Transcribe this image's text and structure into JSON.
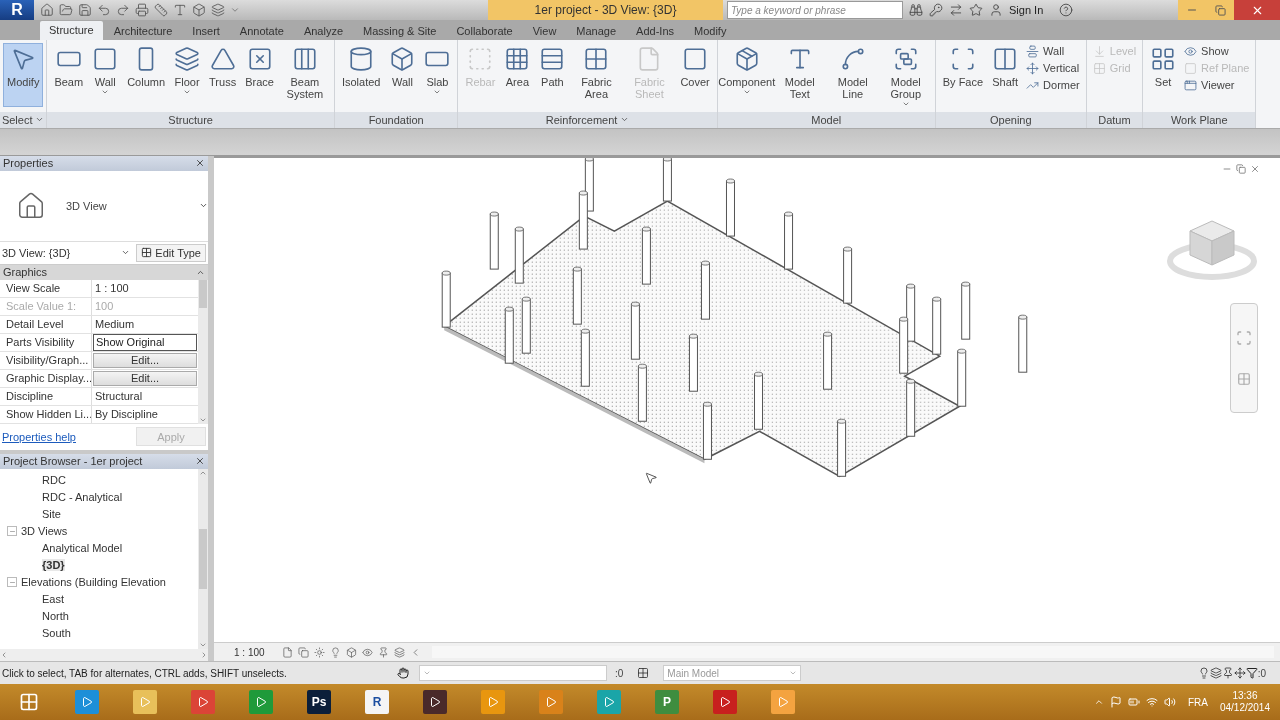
{
  "title_bar": {
    "app_button": "R",
    "title": "1er project - 3D View: {3D}",
    "search_placeholder": "Type a keyword or phrase",
    "sign_in": "Sign In"
  },
  "ribbon_tabs": [
    {
      "label": "Structure",
      "selected": true
    },
    {
      "label": "Architecture",
      "selected": false
    },
    {
      "label": "Insert",
      "selected": false
    },
    {
      "label": "Annotate",
      "selected": false
    },
    {
      "label": "Analyze",
      "selected": false
    },
    {
      "label": "Massing & Site",
      "selected": false
    },
    {
      "label": "Collaborate",
      "selected": false
    },
    {
      "label": "View",
      "selected": false
    },
    {
      "label": "Manage",
      "selected": false
    },
    {
      "label": "Add-Ins",
      "selected": false
    },
    {
      "label": "Modify",
      "selected": false
    }
  ],
  "ribbon_panels": [
    {
      "name": "Select",
      "menu": true,
      "tools": [
        {
          "label": "Modify",
          "kind": "large",
          "selected": true,
          "disabled": false
        }
      ]
    },
    {
      "name": "Structure",
      "tools": [
        {
          "label": "Beam",
          "kind": "large",
          "selected": false,
          "disabled": false
        },
        {
          "label": "Wall",
          "kind": "large",
          "selected": false,
          "disabled": false,
          "dropdown": true
        },
        {
          "label": "Column",
          "kind": "large",
          "selected": false,
          "disabled": false
        },
        {
          "label": "Floor",
          "kind": "large",
          "selected": false,
          "disabled": false,
          "dropdown": true
        },
        {
          "label": "Truss",
          "kind": "large",
          "selected": false,
          "disabled": false
        },
        {
          "label": "Brace",
          "kind": "large",
          "selected": false,
          "disabled": false
        },
        {
          "label": "Beam System",
          "kind": "large",
          "selected": false,
          "disabled": false
        }
      ]
    },
    {
      "name": "Foundation",
      "tools": [
        {
          "label": "Isolated",
          "kind": "large",
          "selected": false,
          "disabled": false
        },
        {
          "label": "Wall",
          "kind": "large",
          "selected": false,
          "disabled": false
        },
        {
          "label": "Slab",
          "kind": "large",
          "selected": false,
          "disabled": false,
          "dropdown": true
        }
      ]
    },
    {
      "name": "Reinforcement",
      "menu": true,
      "tools": [
        {
          "label": "Rebar",
          "kind": "large",
          "selected": false,
          "disabled": true
        },
        {
          "label": "Area",
          "kind": "large",
          "selected": false,
          "disabled": false
        },
        {
          "label": "Path",
          "kind": "large",
          "selected": false,
          "disabled": false
        },
        {
          "label": "Fabric Area",
          "kind": "large",
          "selected": false,
          "disabled": false
        },
        {
          "label": "Fabric Sheet",
          "kind": "large",
          "selected": false,
          "disabled": true
        },
        {
          "label": "Cover",
          "kind": "large",
          "selected": false,
          "disabled": false
        }
      ]
    },
    {
      "name": "Model",
      "tools": [
        {
          "label": "Component",
          "kind": "large",
          "selected": false,
          "disabled": false,
          "dropdown": true
        },
        {
          "label": "Model Text",
          "kind": "large",
          "selected": false,
          "disabled": false
        },
        {
          "label": "Model Line",
          "kind": "large",
          "selected": false,
          "disabled": false
        },
        {
          "label": "Model Group",
          "kind": "large",
          "selected": false,
          "disabled": false,
          "dropdown": true
        }
      ]
    },
    {
      "name": "Opening",
      "tools": [
        {
          "label": "By Face",
          "kind": "large",
          "selected": false,
          "disabled": false
        },
        {
          "label": "Shaft",
          "kind": "large",
          "selected": false,
          "disabled": false
        },
        {
          "label": "Wall",
          "kind": "small",
          "selected": false,
          "disabled": false
        },
        {
          "label": "Vertical",
          "kind": "small",
          "selected": false,
          "disabled": false
        },
        {
          "label": "Dormer",
          "kind": "small",
          "selected": false,
          "disabled": false
        }
      ]
    },
    {
      "name": "Datum",
      "tools": [
        {
          "label": "Level",
          "kind": "small",
          "selected": false,
          "disabled": true
        },
        {
          "label": "Grid",
          "kind": "small",
          "selected": false,
          "disabled": true
        }
      ]
    },
    {
      "name": "Work Plane",
      "tools": [
        {
          "label": "Set",
          "kind": "large",
          "selected": false,
          "disabled": false
        },
        {
          "label": "Show",
          "kind": "small",
          "selected": false,
          "disabled": false
        },
        {
          "label": "Ref Plane",
          "kind": "small",
          "selected": false,
          "disabled": true
        },
        {
          "label": "Viewer",
          "kind": "small",
          "selected": false,
          "disabled": false
        }
      ]
    }
  ],
  "properties": {
    "title": "Properties",
    "type_name": "3D View",
    "instance": "3D View: {3D}",
    "edit_type": "Edit Type",
    "group": "Graphics",
    "rows": [
      {
        "name": "View Scale",
        "value": "1 : 100",
        "kind": "text",
        "disabled": false
      },
      {
        "name": "Scale Value    1:",
        "value": "100",
        "kind": "text",
        "disabled": true
      },
      {
        "name": "Detail Level",
        "value": "Medium",
        "kind": "text",
        "disabled": false
      },
      {
        "name": "Parts Visibility",
        "value": "Show Original",
        "kind": "field",
        "disabled": false
      },
      {
        "name": "Visibility/Graph...",
        "value": "Edit...",
        "kind": "button",
        "disabled": false
      },
      {
        "name": "Graphic Display...",
        "value": "Edit...",
        "kind": "button",
        "disabled": false
      },
      {
        "name": "Discipline",
        "value": "Structural",
        "kind": "text",
        "disabled": false
      },
      {
        "name": "Show Hidden Li...",
        "value": "By Discipline",
        "kind": "text",
        "disabled": false
      }
    ],
    "help_link": "Properties help",
    "apply": "Apply",
    "apply_disabled": true
  },
  "project_browser": {
    "title": "Project Browser - 1er project",
    "tree": [
      {
        "children": [
          {
            "label": "RDC",
            "selected": false
          },
          {
            "label": "RDC - Analytical",
            "selected": false
          },
          {
            "label": "Site",
            "selected": false
          }
        ]
      },
      {
        "label": "3D Views",
        "expanded": true,
        "selected": false,
        "children": [
          {
            "label": "Analytical Model",
            "selected": false
          },
          {
            "label": "{3D}",
            "selected": true
          }
        ]
      },
      {
        "label": "Elevations (Building Elevation",
        "expanded": true,
        "selected": false,
        "children": [
          {
            "label": "East",
            "selected": false
          },
          {
            "label": "North",
            "selected": false
          },
          {
            "label": "South",
            "selected": false
          }
        ]
      }
    ]
  },
  "view_bar": {
    "scale": "1 : 100"
  },
  "status_bar": {
    "message": "Click to select, TAB for alternates, CTRL adds, SHIFT unselects.",
    "selection_count": ":0",
    "model": "Main Model",
    "filter_count": ":0"
  },
  "taskbar": {
    "apps": [
      {
        "kind": "ie"
      },
      {
        "kind": "folder"
      },
      {
        "kind": "chrome"
      },
      {
        "kind": "store"
      },
      {
        "kind": "ps",
        "label": "Ps"
      },
      {
        "kind": "revit",
        "label": "R"
      },
      {
        "kind": "dark"
      },
      {
        "kind": "orange"
      },
      {
        "kind": "orange2"
      },
      {
        "kind": "teal"
      },
      {
        "kind": "project",
        "label": "P"
      },
      {
        "kind": "red"
      },
      {
        "kind": "media"
      }
    ],
    "language": "FRA",
    "time": "13:36",
    "date": "04/12/2014"
  }
}
